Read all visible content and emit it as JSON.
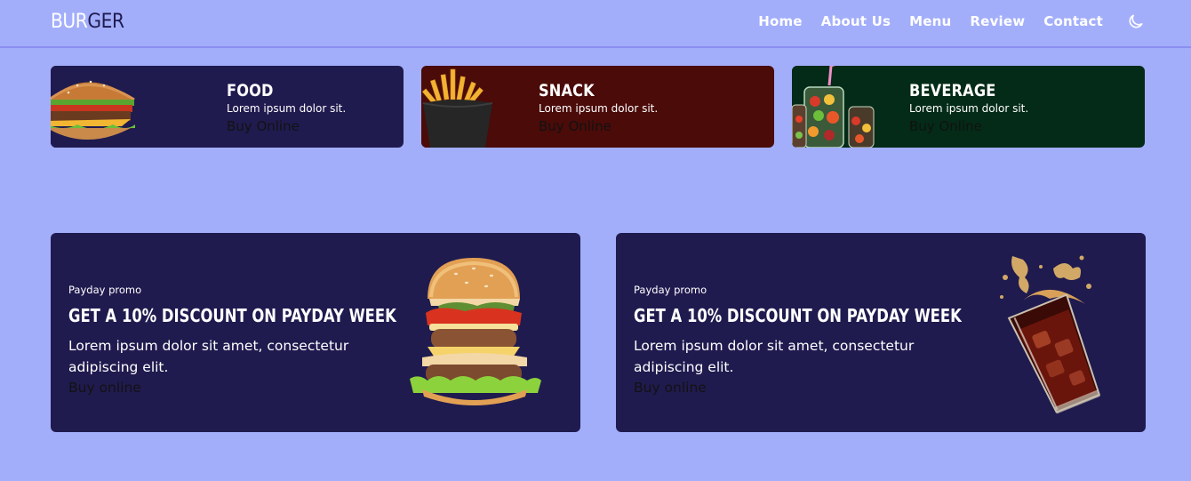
{
  "brand": {
    "part1": "BUR",
    "part2": "GER"
  },
  "nav": {
    "items": [
      "Home",
      "About Us",
      "Menu",
      "Review",
      "Contact"
    ],
    "theme_icon": "moon-icon"
  },
  "categories": [
    {
      "title": "FOOD",
      "subtitle": "Lorem ipsum dolor sit.",
      "cta": "Buy Online",
      "bg": "#1f1b4f",
      "icon": "burger-image"
    },
    {
      "title": "SNACK",
      "subtitle": "Lorem ipsum dolor sit.",
      "cta": "Buy Online",
      "bg": "#4a0b09",
      "icon": "fries-image"
    },
    {
      "title": "BEVERAGE",
      "subtitle": "Lorem ipsum dolor sit.",
      "cta": "Buy Online",
      "bg": "#032b17",
      "icon": "fruit-jar-image"
    }
  ],
  "promos": [
    {
      "tag": "Payday promo",
      "heading": "GET A 10% DISCOUNT ON PAYDAY WEEK",
      "text": "Lorem ipsum dolor sit amet, consectetur adipiscing elit.",
      "cta": "Buy online",
      "icon": "double-burger-image"
    },
    {
      "tag": "Payday promo",
      "heading": "GET A 10% DISCOUNT ON PAYDAY WEEK",
      "text": "Lorem ipsum dolor sit amet, consectetur adipiscing elit.",
      "cta": "Buy online",
      "icon": "cola-glass-image"
    }
  ],
  "colors": {
    "page_bg": "#a3aefb",
    "primary": "#1f1b4f",
    "snack_bg": "#4a0b09",
    "beverage_bg": "#032b17"
  }
}
